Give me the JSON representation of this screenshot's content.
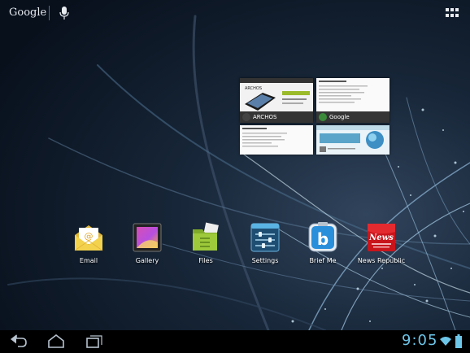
{
  "search_bar": {
    "brand": "Google",
    "icons": [
      "microphone-icon",
      "apps-grid-icon"
    ]
  },
  "recent_apps": [
    {
      "name": "ARCHOS",
      "icon": "archos-icon"
    },
    {
      "name": "Google",
      "icon": "google-icon"
    },
    {
      "name": "",
      "icon": ""
    },
    {
      "name": "",
      "icon": ""
    }
  ],
  "thumbnails_text": {
    "archos_logo": "ARCHOS"
  },
  "dock": [
    {
      "label": "Email",
      "icon": "email-icon"
    },
    {
      "label": "Gallery",
      "icon": "gallery-icon"
    },
    {
      "label": "Files",
      "icon": "files-icon"
    },
    {
      "label": "Settings",
      "icon": "settings-icon"
    },
    {
      "label": "Brief Me",
      "icon": "brief-me-icon",
      "glyph": "b"
    },
    {
      "label": "News Republic",
      "icon": "news-republic-icon",
      "glyph": "News"
    }
  ],
  "status_bar": {
    "time": "9:05",
    "nav_icons": [
      "back-icon",
      "home-icon",
      "recent-apps-icon"
    ],
    "status_icons": [
      "wifi-icon",
      "battery-icon"
    ],
    "clock_color": "#6dc6e8"
  }
}
